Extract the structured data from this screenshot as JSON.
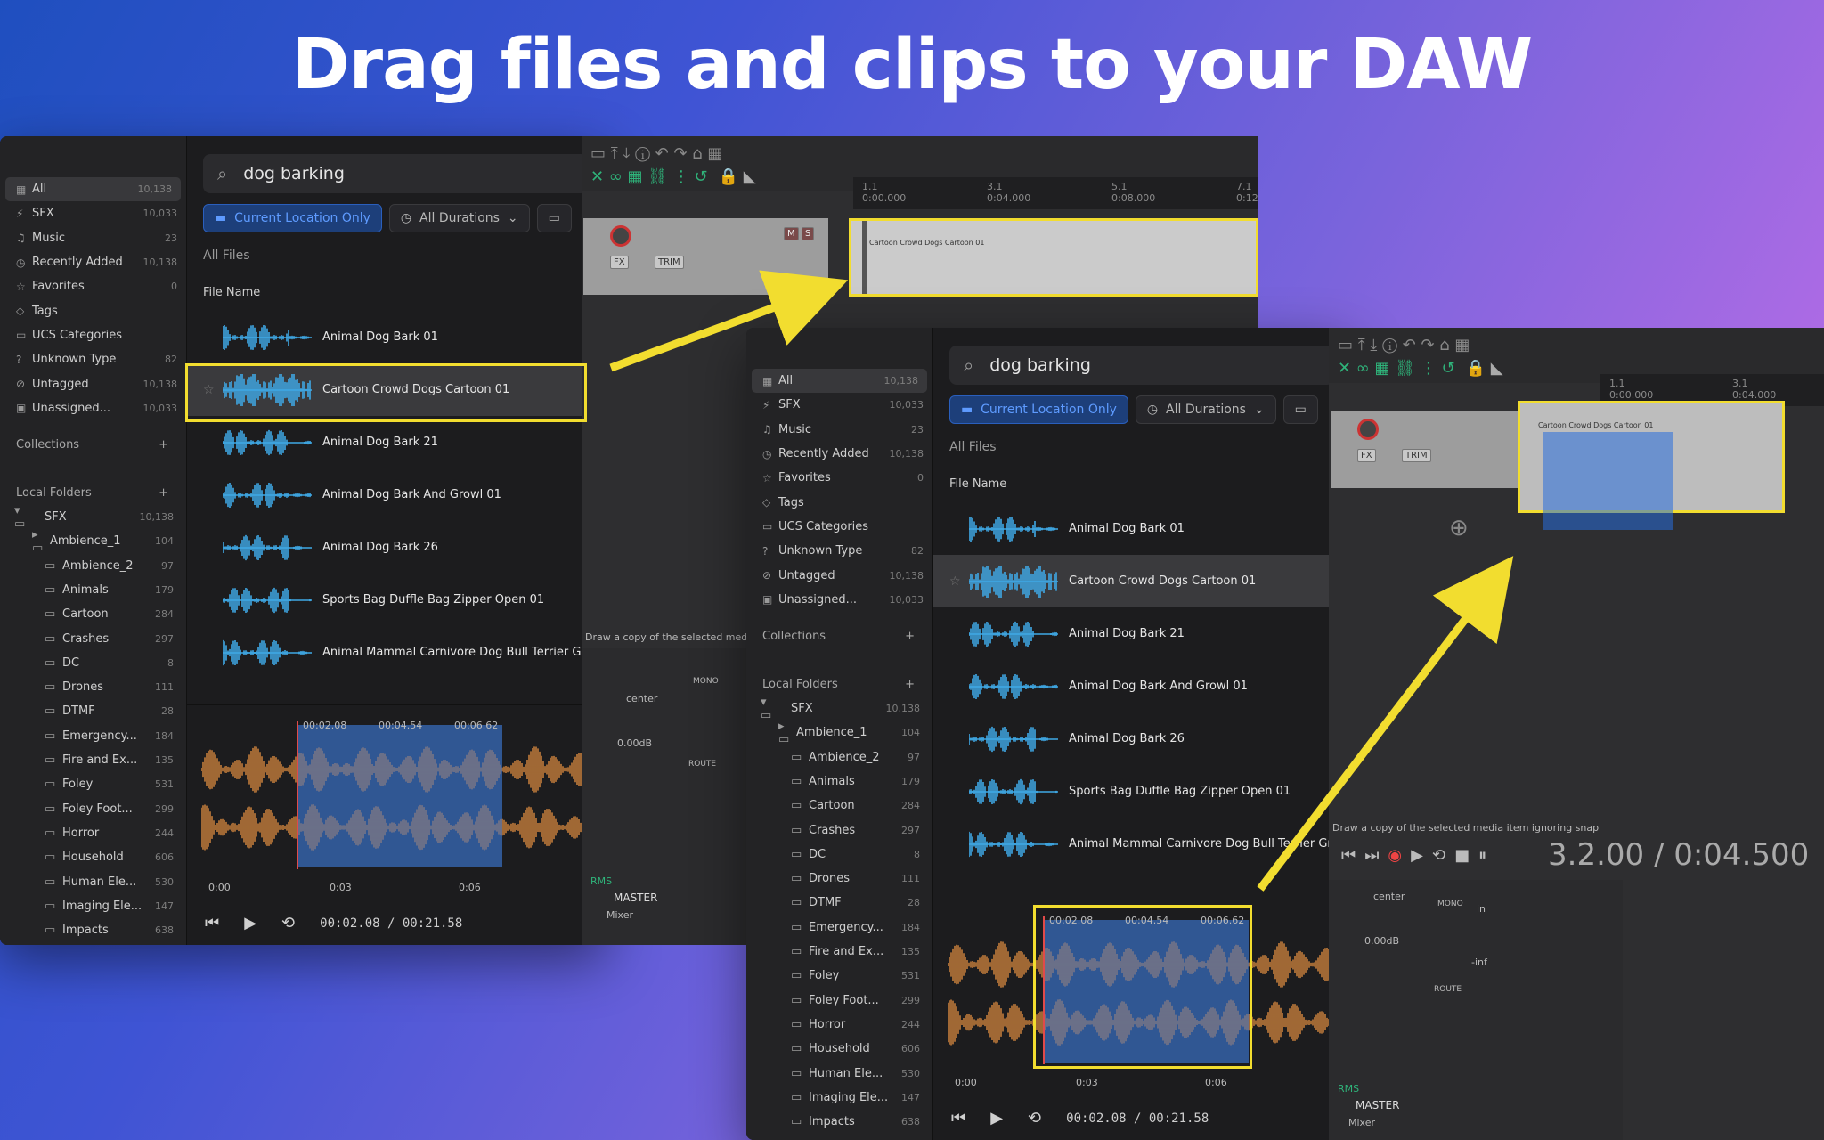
{
  "headline": "Drag files and clips to your DAW",
  "colors": {
    "highlight": "#f2dd2f",
    "accent": "#2f8ddc",
    "wave_blue": "#3fa9e6",
    "wave_orange": "#d98a3f"
  },
  "browser": {
    "search_value": "dog barking",
    "filters": {
      "location": "Current Location Only",
      "durations": "All Durations"
    },
    "list_title": "All Files",
    "column_header": "File Name",
    "library": [
      {
        "icon": "grid-icon",
        "label": "All",
        "count": "10,138"
      },
      {
        "icon": "sfx-icon",
        "label": "SFX",
        "count": "10,033"
      },
      {
        "icon": "music-icon",
        "label": "Music",
        "count": "23"
      },
      {
        "icon": "clock-icon",
        "label": "Recently Added",
        "count": "10,138"
      },
      {
        "icon": "star-icon",
        "label": "Favorites",
        "count": "0"
      },
      {
        "icon": "tag-icon",
        "label": "Tags",
        "count": ""
      },
      {
        "icon": "folder-icon",
        "label": "UCS Categories",
        "count": ""
      },
      {
        "icon": "question-icon",
        "label": "Unknown Type",
        "count": "82"
      },
      {
        "icon": "untagged-icon",
        "label": "Untagged",
        "count": "10,138"
      },
      {
        "icon": "box-icon",
        "label": "Unassigned...",
        "count": "10,033"
      }
    ],
    "collections_label": "Collections",
    "local_folders_label": "Local Folders",
    "root_folder": {
      "label": "SFX",
      "count": "10,138"
    },
    "folders": [
      {
        "label": "Ambience_1",
        "count": "104"
      },
      {
        "label": "Ambience_2",
        "count": "97"
      },
      {
        "label": "Animals",
        "count": "179"
      },
      {
        "label": "Cartoon",
        "count": "284"
      },
      {
        "label": "Crashes",
        "count": "297"
      },
      {
        "label": "DC",
        "count": "8"
      },
      {
        "label": "Drones",
        "count": "111"
      },
      {
        "label": "DTMF",
        "count": "28"
      },
      {
        "label": "Emergency...",
        "count": "184"
      },
      {
        "label": "Fire and Ex...",
        "count": "135"
      },
      {
        "label": "Foley",
        "count": "531"
      },
      {
        "label": "Foley Foot...",
        "count": "299"
      },
      {
        "label": "Horror",
        "count": "244"
      },
      {
        "label": "Household",
        "count": "606"
      },
      {
        "label": "Human Ele...",
        "count": "530"
      },
      {
        "label": "Imaging Ele...",
        "count": "147"
      },
      {
        "label": "Impacts",
        "count": "638"
      }
    ],
    "files": [
      "Animal Dog Bark 01",
      "Cartoon Crowd Dogs Cartoon 01",
      "Animal Dog Bark 21",
      "Animal Dog Bark And Growl 01",
      "Animal Dog Bark 26",
      "Sports Bag Duffle Bag Zipper Open 01",
      "Animal Mammal Carnivore Dog Bull Terrier Growl"
    ],
    "player": {
      "sel_start": "00:02.08",
      "sel_mid": "00:04.54",
      "sel_end": "00:06.62",
      "ticks": [
        "0:00",
        "0:03",
        "0:06"
      ],
      "counter": "00:02.08 / 00:21.58"
    }
  },
  "daw": {
    "ruler": [
      {
        "bar": "1.1",
        "time": "0:00.000"
      },
      {
        "bar": "3.1",
        "time": "0:04.000"
      },
      {
        "bar": "5.1",
        "time": "0:08.000"
      },
      {
        "bar": "7.1",
        "time": "0:12"
      }
    ],
    "track_buttons": {
      "fx": "FX",
      "trim": "TRIM",
      "mute": "M",
      "solo": "S"
    },
    "status_hint_1": "Draw a copy of the selected med",
    "status_hint_2": "Draw a copy of the selected media item ignoring snap",
    "transport_readout": "3.2.00 / 0:04.500",
    "mixer": {
      "center": "center",
      "db": "0.00dB",
      "inf": "-inf",
      "rms": "RMS",
      "master": "MASTER",
      "tab": "Mixer",
      "mono": "MONO",
      "route": "ROUTE",
      "in": "in"
    },
    "clip_label": "Cartoon Crowd Dogs Cartoon 01"
  }
}
